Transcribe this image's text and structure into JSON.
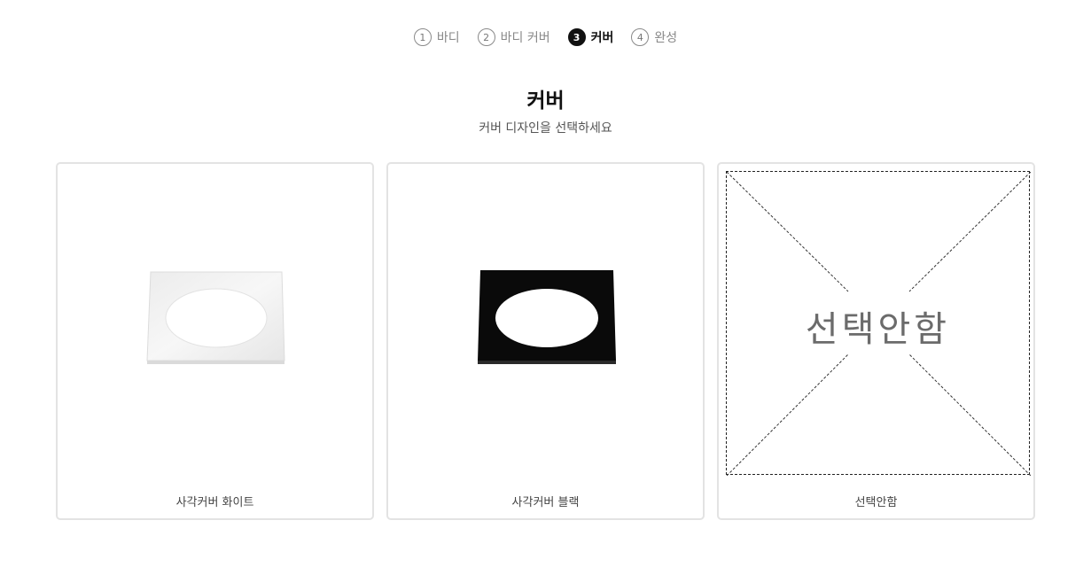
{
  "stepper": {
    "steps": [
      {
        "number": "1",
        "label": "바디",
        "active": false
      },
      {
        "number": "2",
        "label": "바디 커버",
        "active": false
      },
      {
        "number": "3",
        "label": "커버",
        "active": true
      },
      {
        "number": "4",
        "label": "완성",
        "active": false
      }
    ]
  },
  "header": {
    "title": "커버",
    "subtitle": "커버 디자인을 선택하세요"
  },
  "options": [
    {
      "caption": "사각커버 화이트",
      "finish": "white",
      "color": "#f2f2f2"
    },
    {
      "caption": "사각커버 블랙",
      "finish": "black",
      "color": "#0a0a0a"
    },
    {
      "caption": "선택안함",
      "placeholder_text": "선택안함"
    }
  ]
}
